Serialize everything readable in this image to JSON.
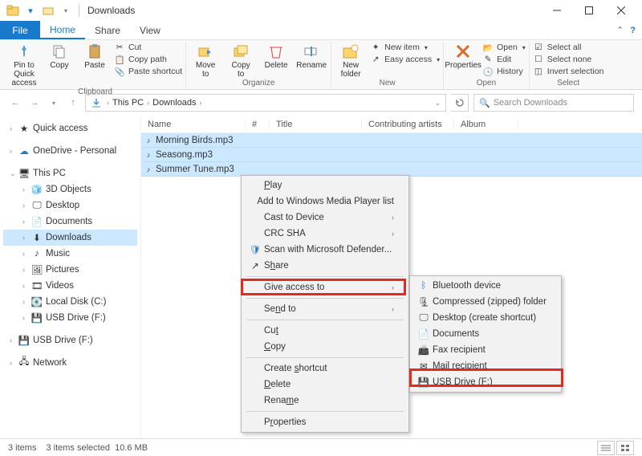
{
  "window": {
    "title": "Downloads"
  },
  "tabs": {
    "file": "File",
    "home": "Home",
    "share": "Share",
    "view": "View"
  },
  "ribbon": {
    "pin": "Pin to Quick\naccess",
    "copy": "Copy",
    "paste": "Paste",
    "cut": "Cut",
    "copypath": "Copy path",
    "pasteshortcut": "Paste shortcut",
    "group_clipboard": "Clipboard",
    "moveto": "Move\nto",
    "copyto": "Copy\nto",
    "delete": "Delete",
    "rename": "Rename",
    "group_organize": "Organize",
    "newfolder": "New\nfolder",
    "newitem": "New item",
    "easyaccess": "Easy access",
    "group_new": "New",
    "properties": "Properties",
    "open": "Open",
    "edit": "Edit",
    "history": "History",
    "group_open": "Open",
    "selectall": "Select all",
    "selectnone": "Select none",
    "invertsel": "Invert selection",
    "group_select": "Select"
  },
  "breadcrumbs": {
    "pc": "This PC",
    "dl": "Downloads"
  },
  "search": {
    "placeholder": "Search Downloads"
  },
  "nav": {
    "quick": "Quick access",
    "onedrive": "OneDrive - Personal",
    "thispc": "This PC",
    "objects3d": "3D Objects",
    "desktop": "Desktop",
    "documents": "Documents",
    "downloads": "Downloads",
    "music": "Music",
    "pictures": "Pictures",
    "videos": "Videos",
    "localdisk": "Local Disk (C:)",
    "usb1": "USB Drive (F:)",
    "usb2": "USB Drive (F:)",
    "network": "Network"
  },
  "columns": {
    "name": "Name",
    "num": "#",
    "title": "Title",
    "artist": "Contributing artists",
    "album": "Album"
  },
  "files": [
    {
      "name": "Morning Birds.mp3"
    },
    {
      "name": "Seasong.mp3"
    },
    {
      "name": "Summer Tune.mp3"
    }
  ],
  "context_main": {
    "play": "Play",
    "addwmp": "Add to Windows Media Player list",
    "cast": "Cast to Device",
    "crc": "CRC SHA",
    "defender": "Scan with Microsoft Defender...",
    "share": "Share",
    "giveaccess": "Give access to",
    "sendto": "Send to",
    "cut": "Cut",
    "copy": "Copy",
    "createshort": "Create shortcut",
    "delete": "Delete",
    "rename": "Rename",
    "properties": "Properties"
  },
  "context_sendto": {
    "bluetooth": "Bluetooth device",
    "zip": "Compressed (zipped) folder",
    "desktop": "Desktop (create shortcut)",
    "documents": "Documents",
    "fax": "Fax recipient",
    "mail": "Mail recipient",
    "usb": "USB Drive (F:)"
  },
  "status": {
    "items": "3 items",
    "selected": "3 items selected",
    "size": "10.6 MB"
  }
}
